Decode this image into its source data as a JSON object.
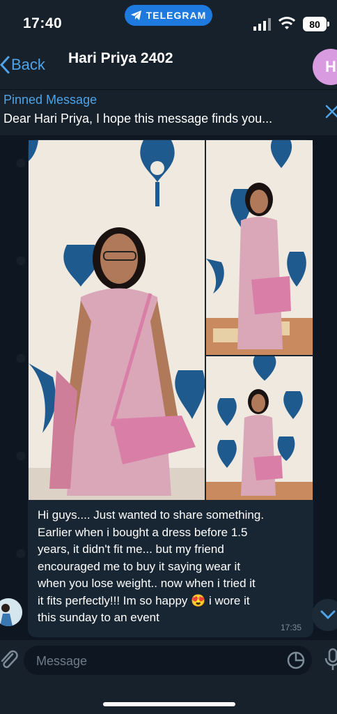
{
  "status": {
    "time": "17:40",
    "pill": "TELEGRAM",
    "battery": "80"
  },
  "header": {
    "back_label": "Back",
    "title": "Hari Priya 2402",
    "avatar_initial": "H"
  },
  "pinned": {
    "title": "Pinned Message",
    "text": "Dear Hari Priya, I hope this message finds you..."
  },
  "message": {
    "text": "Hi guys.... Just wanted to share something.\nEarlier when i bought a dress before 1.5\nyears, it didn't fit me... but my friend\nencouraged me to buy it saying wear it\nwhen you lose weight.. now when i tried it\nit fits perfectly!!! Im so happy 😍 i wore it\nthis sunday to an event",
    "time": "17:35"
  },
  "input": {
    "placeholder": "Message"
  },
  "colors": {
    "accent": "#4fa3e8",
    "bubble": "#182533",
    "header_bg": "#17212b",
    "chat_bg": "#0e1621"
  }
}
